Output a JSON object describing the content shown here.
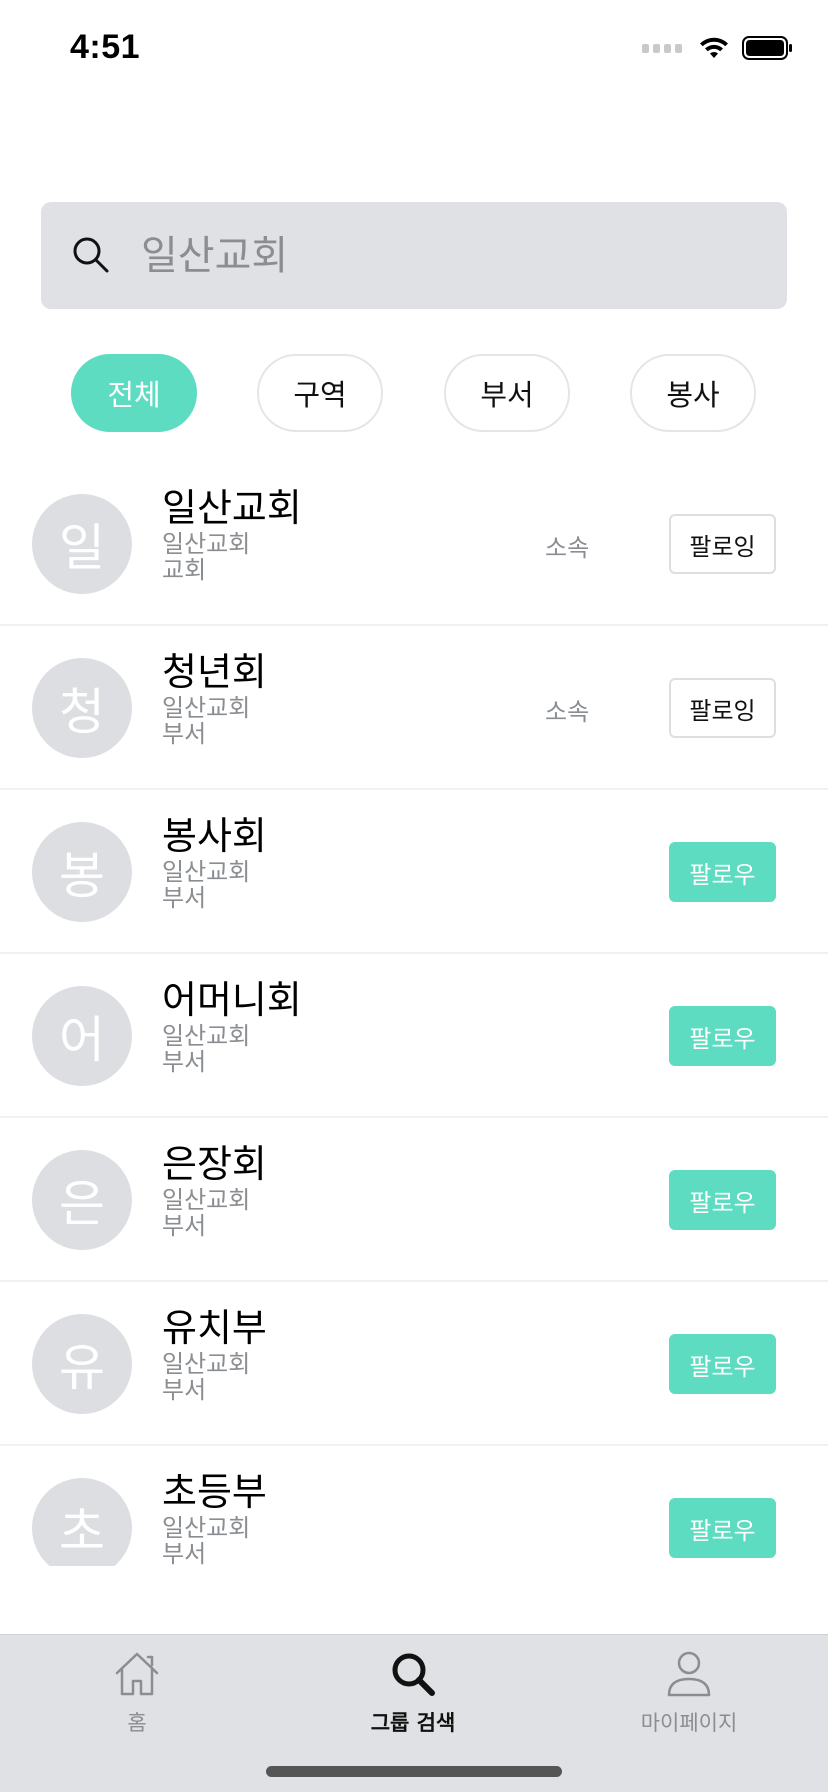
{
  "status_bar": {
    "time": "4:51"
  },
  "search": {
    "placeholder": "일산교회"
  },
  "filters": [
    {
      "label": "전체",
      "active": true
    },
    {
      "label": "구역",
      "active": false
    },
    {
      "label": "부서",
      "active": false
    },
    {
      "label": "봉사",
      "active": false
    }
  ],
  "groups": [
    {
      "initial": "일",
      "name": "일산교회",
      "church": "일산교회",
      "type": "교회",
      "affiliation": "소속",
      "button": "팔로잉"
    },
    {
      "initial": "청",
      "name": "청년회",
      "church": "일산교회",
      "type": "부서",
      "affiliation": "소속",
      "button": "팔로잉"
    },
    {
      "initial": "봉",
      "name": "봉사회",
      "church": "일산교회",
      "type": "부서",
      "affiliation": "",
      "button": "팔로우"
    },
    {
      "initial": "어",
      "name": "어머니회",
      "church": "일산교회",
      "type": "부서",
      "affiliation": "",
      "button": "팔로우"
    },
    {
      "initial": "은",
      "name": "은장회",
      "church": "일산교회",
      "type": "부서",
      "affiliation": "",
      "button": "팔로우"
    },
    {
      "initial": "유",
      "name": "유치부",
      "church": "일산교회",
      "type": "부서",
      "affiliation": "",
      "button": "팔로우"
    },
    {
      "initial": "초",
      "name": "초등부",
      "church": "일산교회",
      "type": "부서",
      "affiliation": "",
      "button": "팔로우"
    }
  ],
  "tab_bar": {
    "home": {
      "label": "홈",
      "icon": "home-icon"
    },
    "search": {
      "label": "그룹 검색",
      "icon": "search-icon",
      "active": true
    },
    "mypage": {
      "label": "마이페이지",
      "icon": "person-icon"
    }
  },
  "colors": {
    "accent": "#5ddcc2",
    "muted_text": "#8a8d91",
    "search_bg": "#dfe1e4"
  }
}
